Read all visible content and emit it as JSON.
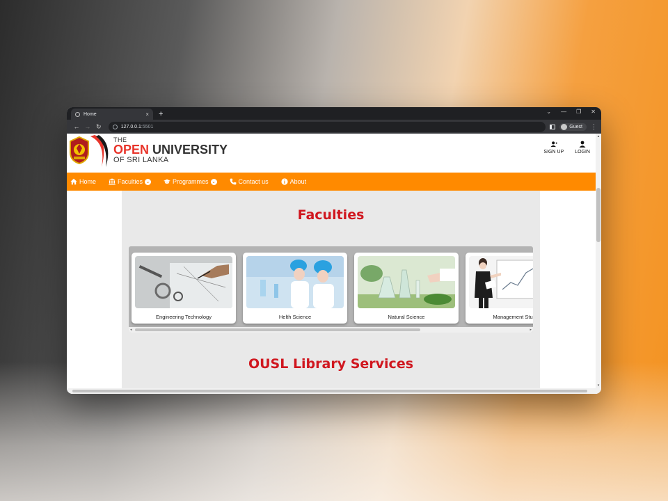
{
  "browser": {
    "tab_title": "Home",
    "tab_close": "×",
    "new_tab": "+",
    "url_host": "127.0.0.1",
    "url_port": ":5501",
    "profile": "Guest",
    "controls": [
      "⌄",
      "—",
      "❐",
      "✕"
    ]
  },
  "header": {
    "logo_the": "THE",
    "logo_open": "OPEN",
    "logo_university": " UNIVERSITY",
    "logo_sri_lanka": "OF SRI LANKA",
    "signup_label": "SIGN UP",
    "login_label": "LOGIN"
  },
  "nav": {
    "home": "Home",
    "faculties": "Faculties",
    "programmes": "Programmes",
    "contact": "Contact us",
    "about": "About"
  },
  "content": {
    "faculties_title": "Faculties",
    "library_title": "OUSL Library Services",
    "cards": [
      {
        "label": "Engineering Technology"
      },
      {
        "label": "Helth Science"
      },
      {
        "label": "Natural Science"
      },
      {
        "label": "Management Studies"
      }
    ]
  },
  "colors": {
    "nav_orange": "#ff8a00",
    "title_red": "#d0171f",
    "logo_red": "#e8342a"
  }
}
